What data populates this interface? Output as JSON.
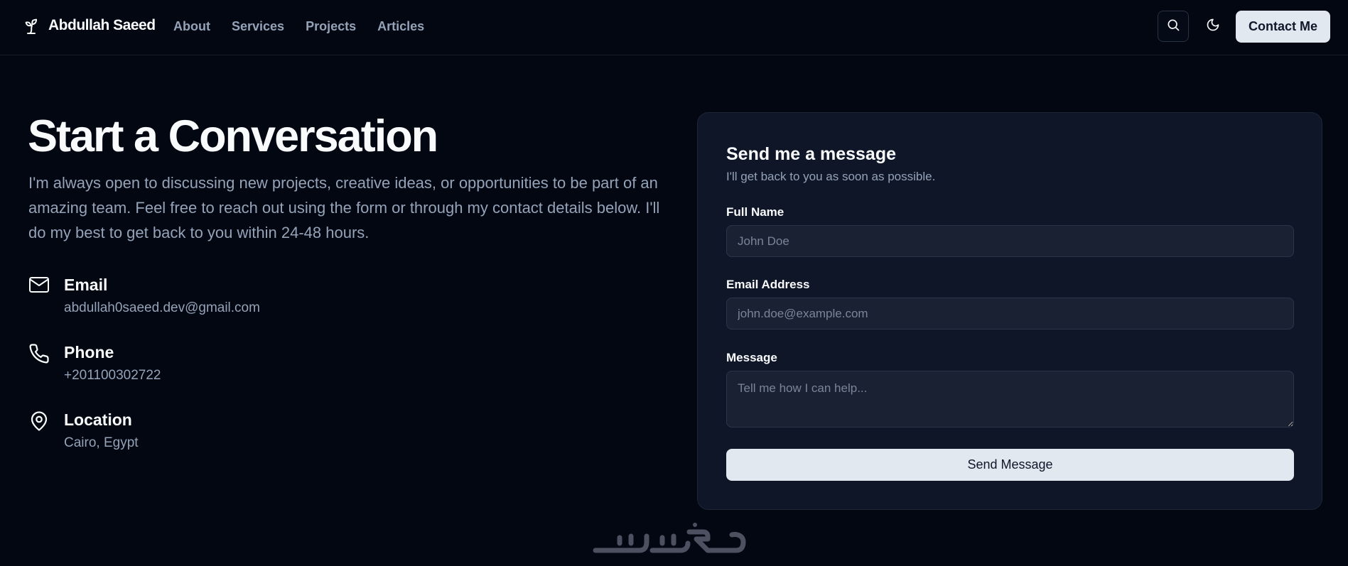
{
  "brand": {
    "name": "Abdullah Saeed",
    "icon": "sprout-icon"
  },
  "nav": {
    "links": [
      {
        "label": "About"
      },
      {
        "label": "Services"
      },
      {
        "label": "Projects"
      },
      {
        "label": "Articles"
      }
    ],
    "search_icon": "search-icon",
    "theme_icon": "moon-icon",
    "contact_label": "Contact Me"
  },
  "hero": {
    "title": "Start a Conversation",
    "description": "I'm always open to discussing new projects, creative ideas, or opportunities to be part of an amazing team. Feel free to reach out using the form or through my contact details below. I'll do my best to get back to you within 24-48 hours."
  },
  "contact_info": [
    {
      "icon": "mail-icon",
      "label": "Email",
      "value": "abdullah0saeed.dev@gmail.com"
    },
    {
      "icon": "phone-icon",
      "label": "Phone",
      "value": "+201100302722"
    },
    {
      "icon": "map-pin-icon",
      "label": "Location",
      "value": "Cairo, Egypt"
    }
  ],
  "form": {
    "title": "Send me a message",
    "subtitle": "I'll get back to you as soon as possible.",
    "name_label": "Full Name",
    "name_placeholder": "John Doe",
    "email_label": "Email Address",
    "email_placeholder": "john.doe@example.com",
    "message_label": "Message",
    "message_placeholder": "Tell me how I can help...",
    "submit_label": "Send Message"
  },
  "watermark": {
    "text": "خمسات"
  },
  "colors": {
    "background": "#030712",
    "card": "#0f1628",
    "muted_text": "#94a3b8",
    "button_light": "#e2e8f0"
  }
}
